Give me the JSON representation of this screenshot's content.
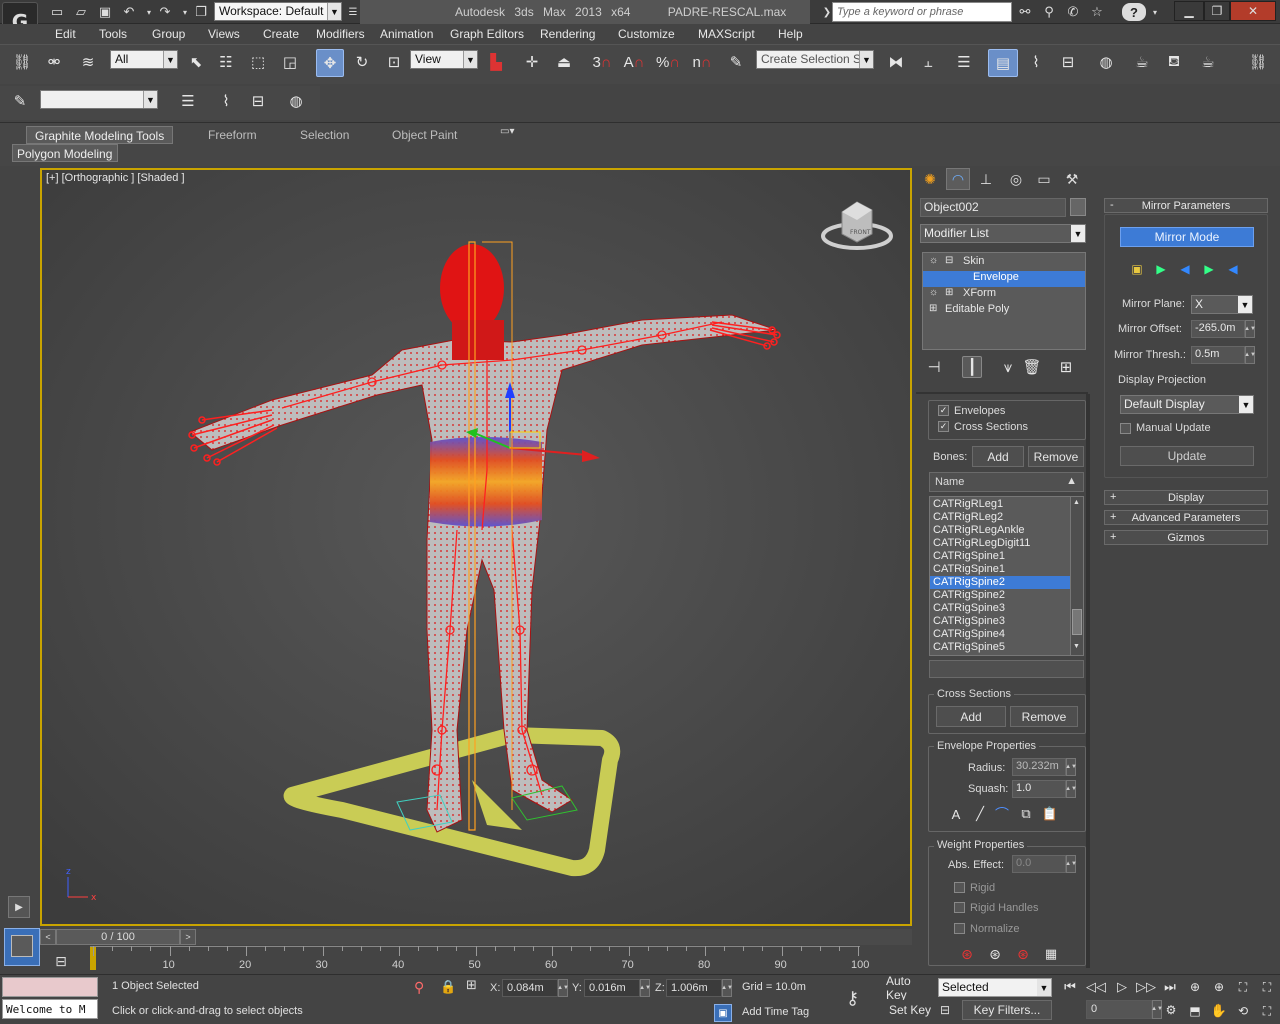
{
  "app": {
    "title": "Autodesk 3ds Max  2013 x64",
    "file": "PADRE-RESCAL.max",
    "logo_text": "G",
    "workspace": "Workspace: Default",
    "search_placeholder": "Type a keyword or phrase"
  },
  "menu": [
    "Edit",
    "Tools",
    "Group",
    "Views",
    "Create",
    "Modifiers",
    "Animation",
    "Graph Editors",
    "Rendering",
    "Customize",
    "MAXScript",
    "Help"
  ],
  "toolbar": {
    "filter": "All",
    "ref_coord": "View",
    "selection_set": "Create Selection Se",
    "snap_label": "3",
    "angle_label": "A",
    "percent_label": "%",
    "spinner_label": "n"
  },
  "ribbon": {
    "tabs": [
      "Graphite Modeling Tools",
      "Freeform",
      "Selection",
      "Object Paint"
    ],
    "active_tab": "Graphite Modeling Tools",
    "sub": "Polygon Modeling"
  },
  "viewport": {
    "label": "[+] [Orthographic ] [Shaded ]",
    "viewcube": "FRONT",
    "axis_x": "x",
    "axis_z": "z"
  },
  "panel": {
    "object_name": "Object002",
    "modifier_list": "Modifier List",
    "stack": [
      {
        "label": "Skin",
        "bullet": "⊟"
      },
      {
        "label": "Envelope",
        "bullet": ""
      },
      {
        "label": "XForm",
        "bullet": "⊞"
      },
      {
        "label": "Editable Poly",
        "bullet": "⊞"
      }
    ],
    "skin": {
      "envelopes": "Envelopes",
      "cross_sections": "Cross Sections",
      "bones_label": "Bones:",
      "add": "Add",
      "remove": "Remove",
      "name_header": "Name",
      "bones": [
        "CATRigRLeg1",
        "CATRigRLeg2",
        "CATRigRLegAnkle",
        "CATRigRLegDigit11",
        "CATRigSpine1",
        "CATRigSpine1",
        "CATRigSpine2",
        "CATRigSpine2",
        "CATRigSpine3",
        "CATRigSpine3",
        "CATRigSpine4",
        "CATRigSpine5"
      ],
      "selected_bone_index": 6,
      "cross_sections_group": "Cross Sections",
      "cs_add": "Add",
      "cs_remove": "Remove",
      "envelope_properties": "Envelope Properties",
      "radius_label": "Radius:",
      "radius": "30.232m",
      "squash_label": "Squash:",
      "squash": "1.0",
      "weight_properties": "Weight Properties",
      "abs_effect_label": "Abs. Effect:",
      "abs_effect": "0.0",
      "rigid": "Rigid",
      "rigid_handles": "Rigid Handles",
      "normalize": "Normalize"
    },
    "mirror": {
      "title": "Mirror Parameters",
      "mode": "Mirror Mode",
      "plane_label": "Mirror Plane:",
      "plane": "X",
      "offset_label": "Mirror Offset:",
      "offset": "-265.0m",
      "thresh_label": "Mirror Thresh.:",
      "thresh": "0.5m",
      "projection_label": "Display Projection",
      "projection": "Default Display",
      "manual_update": "Manual Update",
      "update": "Update"
    },
    "rollouts": [
      "Display",
      "Advanced Parameters",
      "Gizmos"
    ]
  },
  "timeline": {
    "frame": "0 / 100",
    "ticks": [
      "10",
      "20",
      "30",
      "40",
      "50",
      "60",
      "70",
      "80",
      "90",
      "100"
    ]
  },
  "status": {
    "selected": "1 Object Selected",
    "prompt": "Click or click-and-drag to select objects",
    "welcome": "Welcome to M",
    "x_label": "X:",
    "x": "0.084m",
    "y_label": "Y:",
    "y": "0.016m",
    "z_label": "Z:",
    "z": "1.006m",
    "grid": "Grid = 10.0m",
    "add_time_tag": "Add Time Tag",
    "auto_key": "Auto Key",
    "set_key": "Set Key",
    "key_mode": "Selected",
    "key_filters": "Key Filters...",
    "current_frame": "0"
  }
}
